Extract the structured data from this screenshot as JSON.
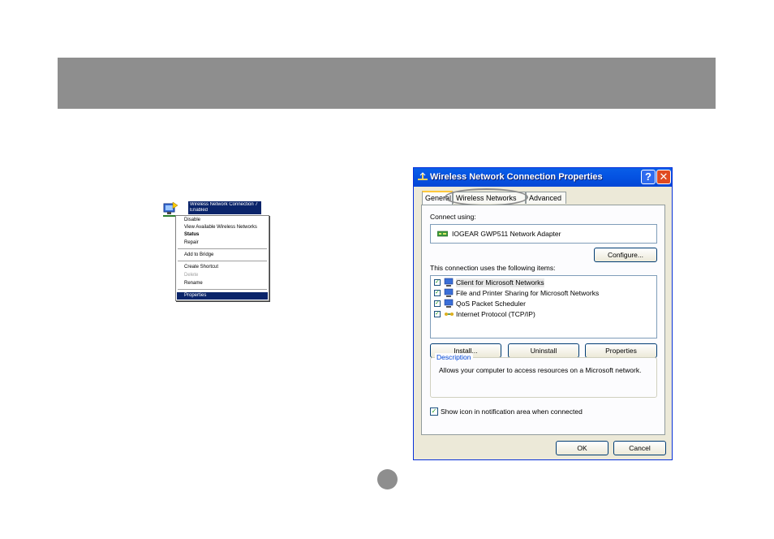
{
  "tray": {
    "tooltip_line1": "Wireless Network Connection 7",
    "tooltip_line2": "Enabled",
    "menu": [
      {
        "label": "Disable",
        "state": "normal"
      },
      {
        "label": "View Available Wireless Networks",
        "state": "normal"
      },
      {
        "label": "Status",
        "state": "bold"
      },
      {
        "label": "Repair",
        "state": "normal"
      },
      {
        "label": "Add to Bridge",
        "state": "normal"
      },
      {
        "label": "Create Shortcut",
        "state": "normal"
      },
      {
        "label": "Delete",
        "state": "disabled"
      },
      {
        "label": "Rename",
        "state": "normal"
      },
      {
        "label": "Properties",
        "state": "selected"
      }
    ]
  },
  "dialog": {
    "title": "Wireless Network Connection Properties",
    "help_glyph": "?",
    "close_glyph": "✕",
    "tabs": [
      "General",
      "Wireless Networks",
      "Advanced"
    ],
    "connect_using_label": "Connect using:",
    "adapter_name": "IOGEAR GWP511 Network Adapter",
    "configure_button": "Configure...",
    "items_label": "This connection uses the following items:",
    "items": [
      {
        "label": "Client for Microsoft Networks",
        "checked": true
      },
      {
        "label": "File and Printer Sharing for Microsoft Networks",
        "checked": true
      },
      {
        "label": "QoS Packet Scheduler",
        "checked": true
      },
      {
        "label": "Internet Protocol (TCP/IP)",
        "checked": true
      }
    ],
    "install_button": "Install...",
    "uninstall_button": "Uninstall",
    "properties_button": "Properties",
    "description_title": "Description",
    "description_text": "Allows your computer to access resources on a Microsoft network.",
    "show_icon_label": "Show icon in notification area when connected",
    "show_icon_checked": true,
    "ok_button": "OK",
    "cancel_button": "Cancel",
    "check_glyph": "✓"
  },
  "colors": {
    "header_band": "#8e8e8e",
    "title_bar": "#0554e3",
    "menu_selection": "#0a246a",
    "description_title": "#0046d5"
  }
}
